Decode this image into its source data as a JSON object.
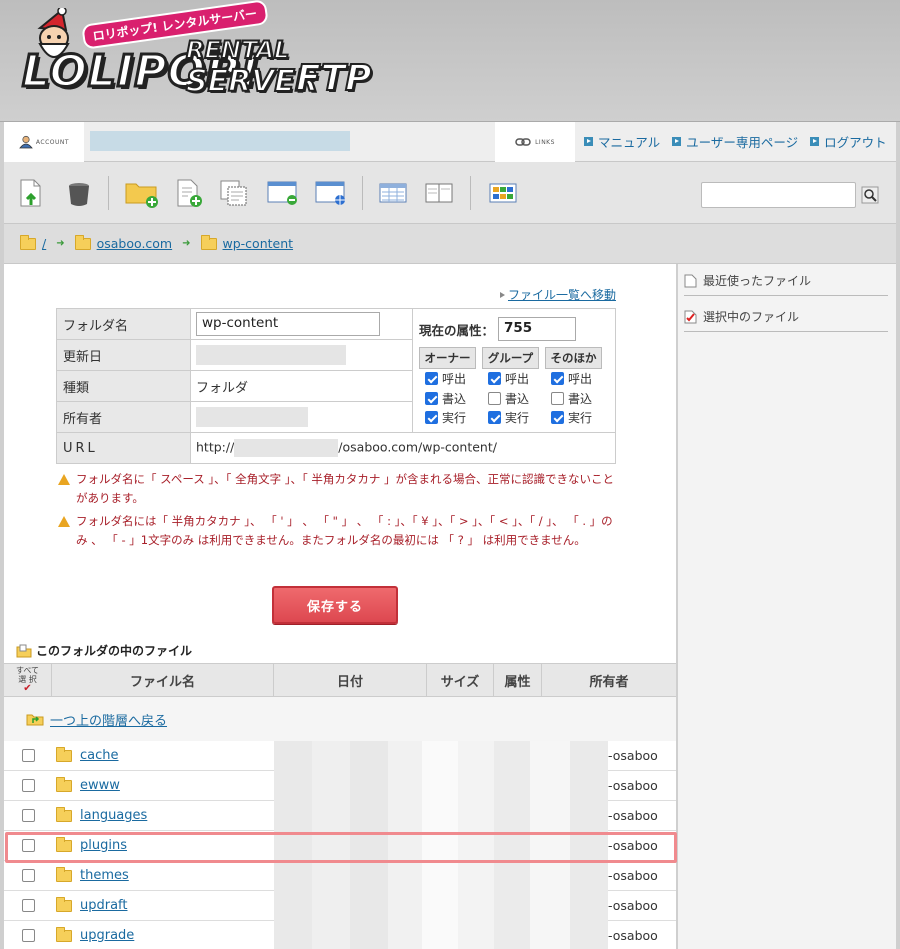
{
  "header": {
    "logo_badge": "ロリポップ! レンタルサーバー",
    "logo_main": "LOLIPOP!",
    "logo_rental": "RENTAL",
    "logo_server": "SERVER",
    "logo_ftp": "FTP"
  },
  "account_bar": {
    "account_label": "ACCOUNT",
    "links_label": "LINKS",
    "links": [
      "マニュアル",
      "ユーザー専用ページ",
      "ログアウト"
    ]
  },
  "toolbar": {
    "icons": [
      "upload-icon",
      "trash-icon",
      "new-folder-icon",
      "new-file-icon",
      "copy-icon",
      "move-icon",
      "web-icon",
      "list-view-icon",
      "split-view-icon",
      "thumbnail-view-icon"
    ]
  },
  "breadcrumb": {
    "items": [
      "/",
      "osaboo.com",
      "wp-content"
    ]
  },
  "sidebar": {
    "recent": "最近使ったファイル",
    "selected": "選択中のファイル"
  },
  "main": {
    "move_link": "ファイル一覧へ移動",
    "props": {
      "folder_name_label": "フォルダ名",
      "folder_name_value": "wp-content",
      "updated_label": "更新日",
      "type_label": "種類",
      "type_value": "フォルダ",
      "owner_label": "所有者",
      "url_label": "URL",
      "url_prefix": "http://",
      "url_suffix": "/osaboo.com/wp-content/"
    },
    "perm": {
      "title": "現在の属性：",
      "value": "755",
      "groups": [
        {
          "label": "オーナー",
          "rows": [
            {
              "label": "呼出",
              "on": true
            },
            {
              "label": "書込",
              "on": true
            },
            {
              "label": "実行",
              "on": true
            }
          ]
        },
        {
          "label": "グループ",
          "rows": [
            {
              "label": "呼出",
              "on": true
            },
            {
              "label": "書込",
              "on": false
            },
            {
              "label": "実行",
              "on": true
            }
          ]
        },
        {
          "label": "そのほか",
          "rows": [
            {
              "label": "呼出",
              "on": true
            },
            {
              "label": "書込",
              "on": false
            },
            {
              "label": "実行",
              "on": true
            }
          ]
        }
      ]
    },
    "warnings": [
      "フォルダ名に「 スペース 」、「 全角文字 」、「 半角カタカナ 」が含まれる場合、正常に認識できないことがあります。",
      "フォルダ名には「 半角カタカナ 」、 「 ' 」 、 「 \" 」 、 「 : 」、「 ¥ 」、「 > 」、「 < 」、「 / 」、 「 . 」のみ 、 「 - 」1文字のみ は利用できません。またフォルダ名の最初には 「 ? 」 は利用できません。"
    ],
    "save_label": "保存する",
    "files_title": "このフォルダの中のファイル",
    "columns": {
      "select_all_1": "すべて",
      "select_all_2": "選 択",
      "name": "ファイル名",
      "date": "日付",
      "size": "サイズ",
      "attr": "属性",
      "owner": "所有者"
    },
    "up_link": "一つ上の階層へ戻る",
    "files": [
      {
        "name": "cache",
        "owner": "-osaboo"
      },
      {
        "name": "ewww",
        "owner": "-osaboo"
      },
      {
        "name": "languages",
        "owner": "-osaboo"
      },
      {
        "name": "plugins",
        "owner": "-osaboo"
      },
      {
        "name": "themes",
        "owner": "-osaboo"
      },
      {
        "name": "updraft",
        "owner": "-osaboo"
      },
      {
        "name": "upgrade",
        "owner": "-osaboo"
      }
    ]
  },
  "colors": {
    "link": "#1a6aa0",
    "warning_text": "#a8202a",
    "save_button": "#e0555b",
    "highlight": "#f08a8e",
    "checkbox_on": "#1f6fe0"
  }
}
